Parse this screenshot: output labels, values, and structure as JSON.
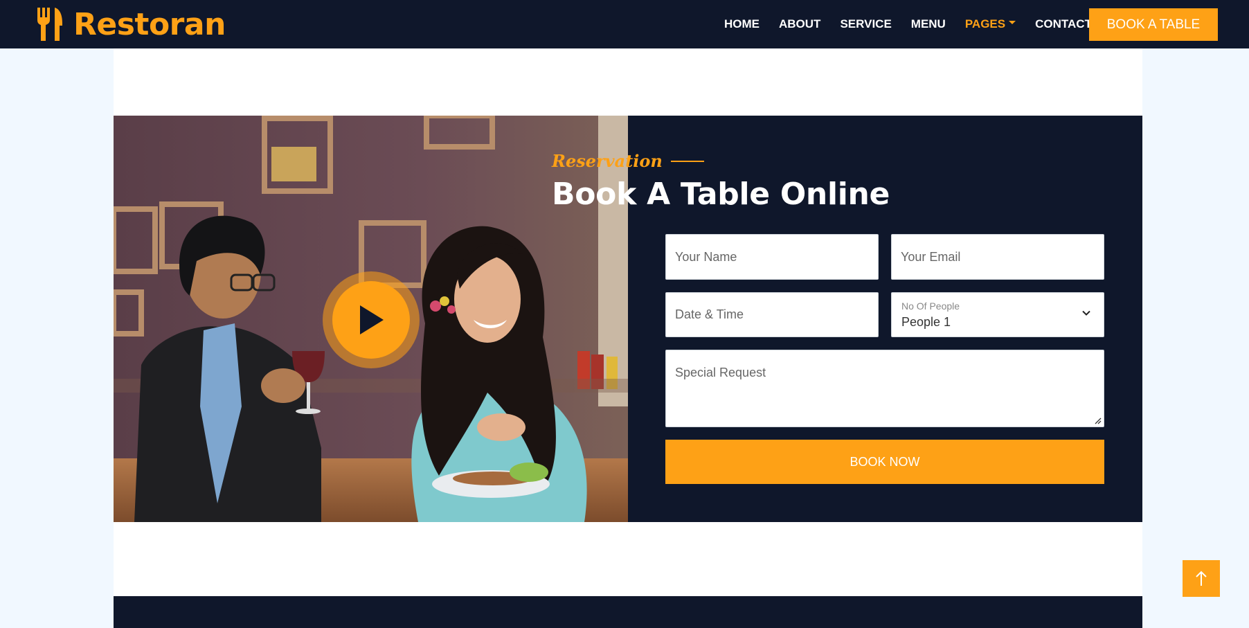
{
  "brand": {
    "name": "Restoran",
    "icon": "utensils-icon"
  },
  "nav": {
    "items": [
      {
        "label": "HOME"
      },
      {
        "label": "ABOUT"
      },
      {
        "label": "SERVICE"
      },
      {
        "label": "MENU"
      },
      {
        "label": "PAGES",
        "active": true,
        "dropdown": true
      },
      {
        "label": "CONTACT"
      }
    ],
    "cta": "BOOK A TABLE"
  },
  "reservation": {
    "subtitle": "Reservation",
    "title": "Book A Table Online",
    "form": {
      "name_placeholder": "Your Name",
      "email_placeholder": "Your Email",
      "datetime_placeholder": "Date & Time",
      "people_label": "No Of People",
      "people_value": "People 1",
      "request_placeholder": "Special Request",
      "submit": "BOOK NOW"
    },
    "video_icon": "play-icon"
  },
  "colors": {
    "primary": "#fea116",
    "dark": "#0f172b",
    "light": "#f1f8ff"
  },
  "back_to_top_icon": "arrow-up-icon"
}
